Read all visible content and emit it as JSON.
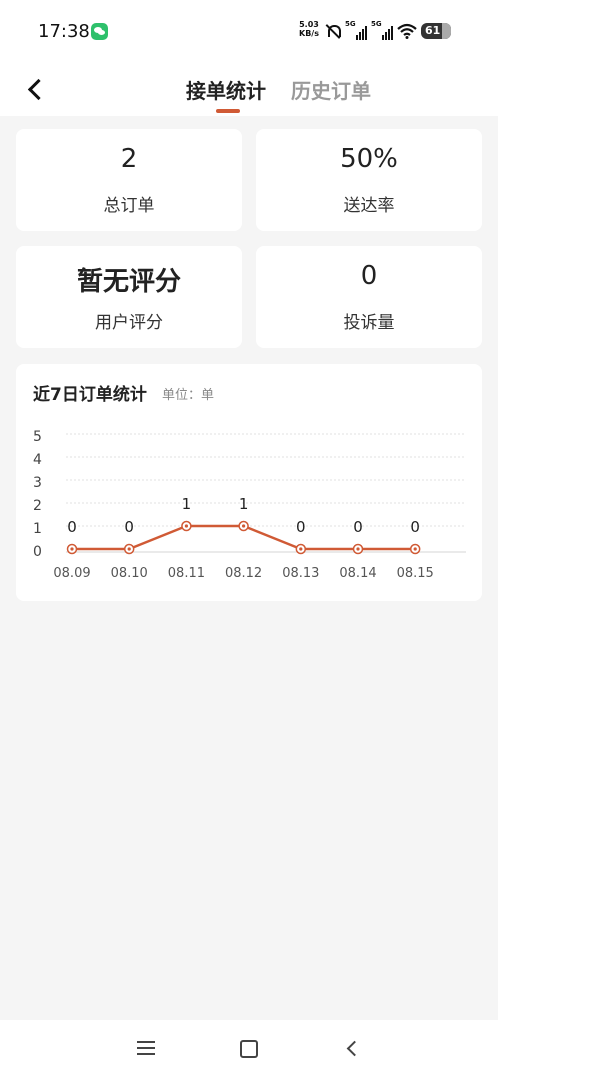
{
  "status_bar": {
    "time": "17:38",
    "speed_value": "5.03",
    "speed_unit": "KB/s",
    "signal_1": "5G",
    "signal_2": "5G",
    "battery": "61",
    "icons": [
      "wechat-icon",
      "mute-icon",
      "signal-icon",
      "wifi-icon",
      "battery-icon"
    ]
  },
  "nav": {
    "tabs": [
      {
        "label": "接单统计",
        "active": true
      },
      {
        "label": "历史订单",
        "active": false
      }
    ],
    "accent": "#d05a35"
  },
  "stats": [
    {
      "value": "2",
      "label": "总订单"
    },
    {
      "value": "50%",
      "label": "送达率"
    },
    {
      "value": "暂无评分",
      "label": "用户评分"
    },
    {
      "value": "0",
      "label": "投诉量"
    }
  ],
  "chart": {
    "title": "近7日订单统计",
    "unit": "单位：单"
  },
  "chart_data": {
    "type": "line",
    "x": [
      "08.09",
      "08.10",
      "08.11",
      "08.12",
      "08.13",
      "08.14",
      "08.15"
    ],
    "series": [
      {
        "values": [
          0,
          0,
          1,
          1,
          0,
          0,
          0
        ]
      }
    ],
    "yticks": [
      0,
      1,
      2,
      3,
      4,
      5
    ],
    "ylim": [
      0,
      5
    ],
    "grid": true,
    "data_labels": true,
    "line_color": "#d05a35"
  }
}
